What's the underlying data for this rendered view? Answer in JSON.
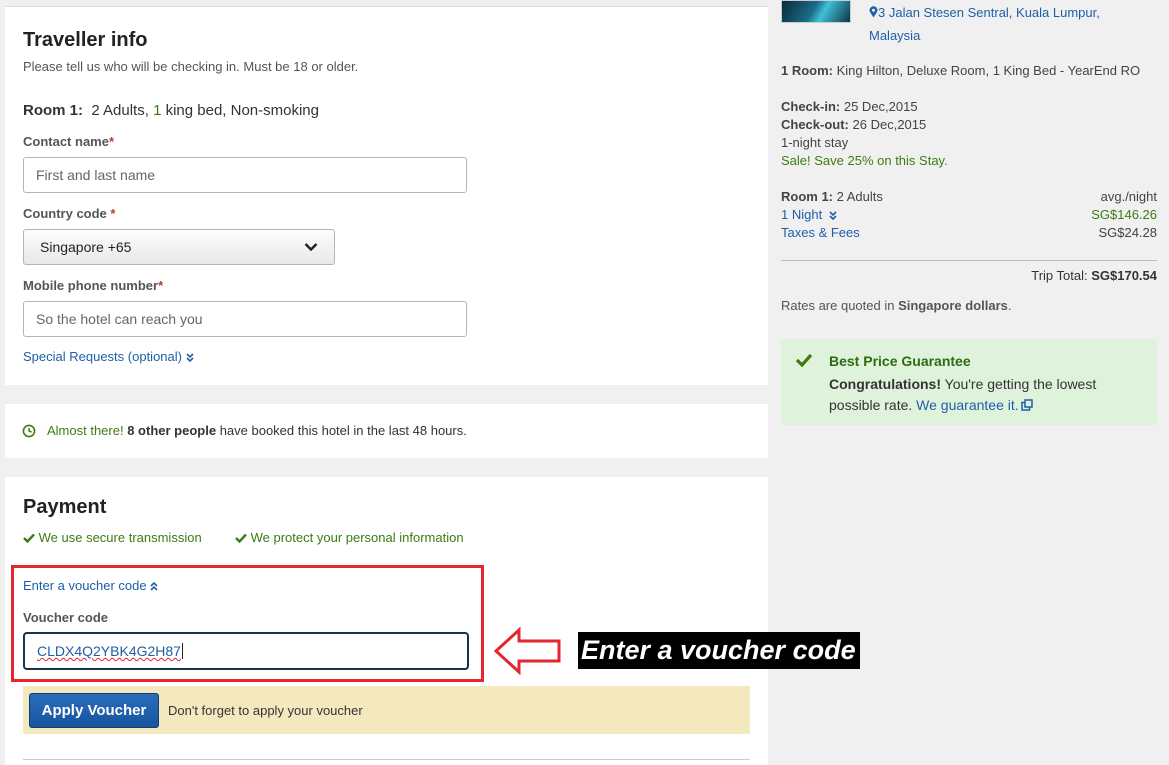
{
  "traveller": {
    "title": "Traveller info",
    "subtitle": "Please tell us who will be checking in. Must be 18 or older.",
    "room_label": "Room 1:",
    "room_desc_pre": "2 Adults, ",
    "room_desc_num": "1",
    "room_desc_post": " king bed, Non-smoking",
    "contact_label": "Contact name",
    "contact_placeholder": "First and last name",
    "country_label": "Country code",
    "country_value": "Singapore +65",
    "phone_label": "Mobile phone number",
    "phone_placeholder": "So the hotel can reach you",
    "special_requests": "Special Requests (optional)",
    "required_mark": "*"
  },
  "notice": {
    "lead": "Almost there!",
    "bold": "8 other people",
    "rest": " have booked this hotel in the last 48 hours."
  },
  "payment": {
    "title": "Payment",
    "secure": "We use secure transmission",
    "protect": "We protect your personal information",
    "voucher_link": "Enter a voucher code",
    "voucher_label": "Voucher code",
    "voucher_value": "CLDX4Q2YBK4G2H87",
    "apply_button": "Apply Voucher",
    "apply_hint": "Don't forget to apply your voucher"
  },
  "annotation": {
    "text": "Enter a voucher code",
    "color": "#e32630"
  },
  "summary": {
    "address_line1": "3 Jalan Stesen Sentral, Kuala Lumpur,",
    "address_line2": "Malaysia",
    "room_label": "1 Room:",
    "room_value": "King Hilton, Deluxe Room, 1 King Bed - YearEnd RO",
    "checkin_label": "Check-in:",
    "checkin_value": "25 Dec,2015",
    "checkout_label": "Check-out:",
    "checkout_value": "26 Dec,2015",
    "stay": "1-night stay",
    "sale": "Sale! Save 25% on this Stay.",
    "room1_label": "Room 1:",
    "room1_value": "2 Adults",
    "avg": "avg./night",
    "nights_link": "1 Night",
    "nights_price": "SG$146.26",
    "taxes_link": "Taxes & Fees",
    "taxes_price": "SG$24.28",
    "total_label": "Trip Total:",
    "total_value": "SG$170.54",
    "rates_pre": "Rates are quoted in ",
    "rates_bold": "Singapore dollars",
    "rates_post": "."
  },
  "guarantee": {
    "title": "Best Price Guarantee",
    "bold": "Congratulations!",
    "text": " You're getting the lowest possible rate.",
    "link": "We guarantee it."
  },
  "colors": {
    "link": "#1f5fa8",
    "green": "#3e7b12",
    "button": "#1a5aa6",
    "hint_bg": "#f4e8be",
    "guarantee_bg": "#dff2dc"
  }
}
